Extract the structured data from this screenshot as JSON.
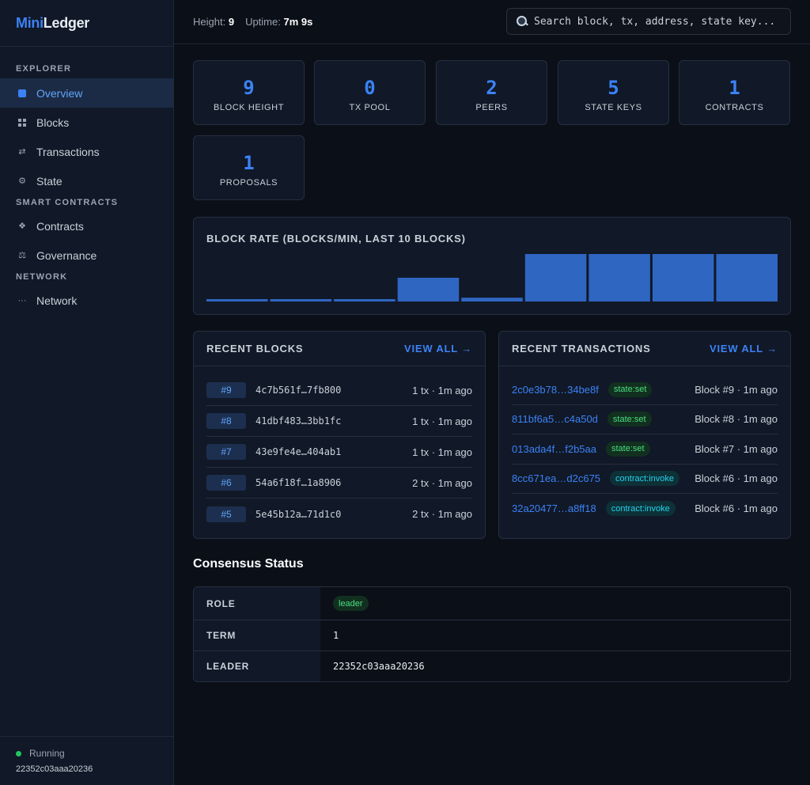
{
  "brand": {
    "mini": "Mini",
    "ledger": "Ledger"
  },
  "sidebar": {
    "sections": [
      {
        "title": "EXPLORER"
      },
      {
        "title": "SMART CONTRACTS"
      },
      {
        "title": "NETWORK"
      }
    ],
    "items": [
      {
        "label": "Overview",
        "icon": "square-icon",
        "active": true
      },
      {
        "label": "Blocks",
        "icon": "grid-icon"
      },
      {
        "label": "Transactions",
        "icon": "swap-icon",
        "glyph": "⇄"
      },
      {
        "label": "State",
        "icon": "gear-icon",
        "glyph": "⚙"
      },
      {
        "label": "Contracts",
        "icon": "diamond-icon",
        "glyph": "❖"
      },
      {
        "label": "Governance",
        "icon": "scales-icon",
        "glyph": "⚖"
      },
      {
        "label": "Network",
        "icon": "dots-icon",
        "glyph": "···"
      }
    ],
    "footer": {
      "status": "Running",
      "node_id": "22352c03aaa20236",
      "status_color": "#22c55e"
    }
  },
  "topbar": {
    "height_label": "Height:",
    "height_value": "9",
    "uptime_label": "Uptime:",
    "uptime_value": "7m 9s",
    "search_placeholder": "Search block, tx, address, state key..."
  },
  "stats": [
    {
      "value": "9",
      "label": "BLOCK HEIGHT"
    },
    {
      "value": "0",
      "label": "TX POOL"
    },
    {
      "value": "2",
      "label": "PEERS"
    },
    {
      "value": "5",
      "label": "STATE KEYS"
    },
    {
      "value": "1",
      "label": "CONTRACTS"
    },
    {
      "value": "1",
      "label": "PROPOSALS"
    }
  ],
  "chart_data": {
    "type": "bar",
    "title": "BLOCK RATE (BLOCKS/MIN, LAST 10 BLOCKS)",
    "series": [
      {
        "values": [
          0.05,
          0.05,
          0.05,
          0.5,
          0.08,
          1,
          1,
          1,
          1
        ]
      }
    ],
    "ylim": [
      0,
      1
    ],
    "color": "#2f66c2"
  },
  "recent_blocks": {
    "title": "RECENT BLOCKS",
    "view_all": "VIEW ALL →",
    "rows": [
      {
        "num": "#9",
        "hash": "4c7b561f…7fb800",
        "meta": "1 tx · 1m ago"
      },
      {
        "num": "#8",
        "hash": "41dbf483…3bb1fc",
        "meta": "1 tx · 1m ago"
      },
      {
        "num": "#7",
        "hash": "43e9fe4e…404ab1",
        "meta": "1 tx · 1m ago"
      },
      {
        "num": "#6",
        "hash": "54a6f18f…1a8906",
        "meta": "2 tx · 1m ago"
      },
      {
        "num": "#5",
        "hash": "5e45b12a…71d1c0",
        "meta": "2 tx · 1m ago"
      }
    ]
  },
  "recent_transactions": {
    "title": "RECENT TRANSACTIONS",
    "view_all": "VIEW ALL →",
    "rows": [
      {
        "hash": "2c0e3b78…34be8f",
        "type": "state:set",
        "kind": "set",
        "meta": "Block #9 · 1m ago"
      },
      {
        "hash": "811bf6a5…c4a50d",
        "type": "state:set",
        "kind": "set",
        "meta": "Block #8 · 1m ago"
      },
      {
        "hash": "013ada4f…f2b5aa",
        "type": "state:set",
        "kind": "set",
        "meta": "Block #7 · 1m ago"
      },
      {
        "hash": "8cc671ea…d2c675",
        "type": "contract:invoke",
        "kind": "invoke",
        "meta": "Block #6 · 1m ago"
      },
      {
        "hash": "32a20477…a8ff18",
        "type": "contract:invoke",
        "kind": "invoke",
        "meta": "Block #6 · 1m ago"
      }
    ]
  },
  "consensus": {
    "title": "Consensus Status",
    "rows": [
      {
        "key": "ROLE",
        "value": "leader",
        "pill": true
      },
      {
        "key": "TERM",
        "value": "1"
      },
      {
        "key": "LEADER",
        "value": "22352c03aaa20236"
      }
    ]
  }
}
